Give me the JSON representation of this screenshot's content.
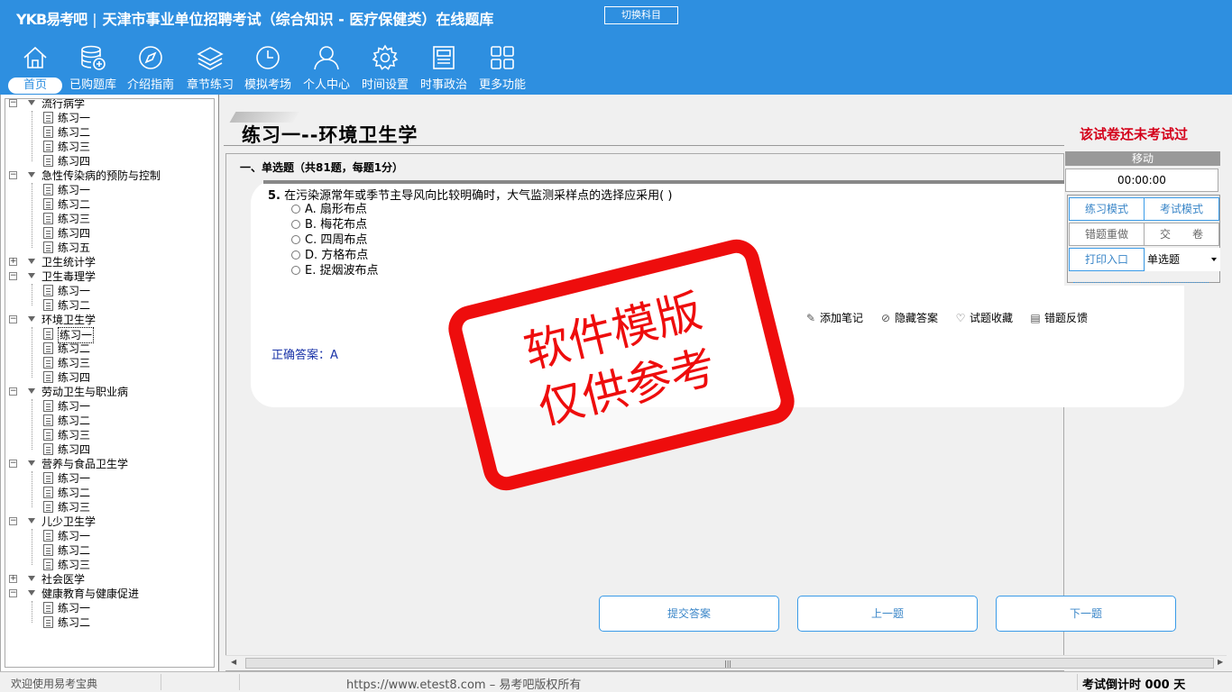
{
  "header": {
    "logo": "YKB易考吧",
    "title": "天津市事业单位招聘考试（综合知识 - 医疗保健类）在线题库",
    "switch_label": "切换科目"
  },
  "nav": [
    {
      "label": "首页",
      "icon": "home-icon"
    },
    {
      "label": "已购题库",
      "icon": "database-icon"
    },
    {
      "label": "介绍指南",
      "icon": "compass-icon"
    },
    {
      "label": "章节练习",
      "icon": "layers-icon"
    },
    {
      "label": "模拟考场",
      "icon": "clock-icon"
    },
    {
      "label": "个人中心",
      "icon": "user-icon"
    },
    {
      "label": "时间设置",
      "icon": "gear-icon"
    },
    {
      "label": "时事政治",
      "icon": "newspaper-icon"
    },
    {
      "label": "更多功能",
      "icon": "grid-icon"
    }
  ],
  "tree": [
    {
      "label": "流行病学",
      "children": [
        "练习一",
        "练习二",
        "练习三",
        "练习四"
      ]
    },
    {
      "label": "急性传染病的预防与控制",
      "children": [
        "练习一",
        "练习二",
        "练习三",
        "练习四",
        "练习五"
      ]
    },
    {
      "label": "卫生统计学",
      "children": []
    },
    {
      "label": "卫生毒理学",
      "children": [
        "练习一",
        "练习二"
      ]
    },
    {
      "label": "环境卫生学",
      "children": [
        "练习一",
        "练习二",
        "练习三",
        "练习四"
      ]
    },
    {
      "label": "劳动卫生与职业病",
      "children": [
        "练习一",
        "练习二",
        "练习三",
        "练习四"
      ]
    },
    {
      "label": "营养与食品卫生学",
      "children": [
        "练习一",
        "练习二",
        "练习三"
      ]
    },
    {
      "label": "儿少卫生学",
      "children": [
        "练习一",
        "练习二",
        "练习三"
      ]
    },
    {
      "label": "社会医学",
      "children": []
    },
    {
      "label": "健康教育与健康促进",
      "children": [
        "练习一",
        "练习二"
      ]
    }
  ],
  "main": {
    "title": "练习一--环境卫生学",
    "status": "该试卷还未考试过",
    "section": "一、单选题（共81题，每题1分）",
    "question_number": "5.",
    "question": "在污染源常年或季节主导风向比较明确时，大气监测采样点的选择应采用( )",
    "options": [
      "A. 扇形布点",
      "B. 梅花布点",
      "C. 四周布点",
      "D. 方格布点",
      "E. 捉烟波布点"
    ],
    "tools": [
      {
        "label": "添加笔记",
        "icon": "pencil-icon"
      },
      {
        "label": "隐藏答案",
        "icon": "eye-off-icon"
      },
      {
        "label": "试题收藏",
        "icon": "heart-icon"
      },
      {
        "label": "错题反馈",
        "icon": "feedback-icon"
      }
    ],
    "answer": "正确答案：A",
    "buttons": {
      "submit": "提交答案",
      "prev": "上一题",
      "next": "下一题"
    }
  },
  "side": {
    "header": "移动",
    "timer": "00:00:00",
    "practice_mode": "练习模式",
    "exam_mode": "考试模式",
    "redo_wrong": "错题重做",
    "hand_in": "交　　卷",
    "print": "打印入口",
    "type_select": "单选题"
  },
  "stamp": {
    "line1": "软件模版",
    "line2": "仅供参考"
  },
  "footer": {
    "welcome": "欢迎使用易考宝典",
    "copyright": "https://www.etest8.com – 易考吧版权所有",
    "countdown": "考试倒计时 000 天"
  },
  "colors": {
    "header_bg": "#2e8fe0",
    "status_red": "#d4001a",
    "stamp_red": "#ee0d0d",
    "answer_blue": "#1a33a8"
  }
}
